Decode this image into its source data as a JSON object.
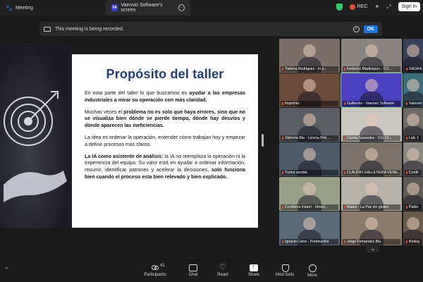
{
  "tabs": {
    "meeting": "Meeting",
    "share": "Vaenvio Software's screen",
    "share_badge": "VA"
  },
  "topbar": {
    "rec_label": "REC",
    "signin_label": "Sign in"
  },
  "banner": {
    "text": "This meeting is being recorded.",
    "ok_label": "OK"
  },
  "slide": {
    "title": "Propósito del taller",
    "paragraphs": [
      {
        "parts": [
          {
            "t": "En esta parte del taller lo que buscamos es ",
            "b": false
          },
          {
            "t": "ayudar a las empresas industriales a mirar su operación con más claridad.",
            "b": true
          }
        ]
      },
      {
        "parts": [
          {
            "t": "Muchas veces el ",
            "b": false
          },
          {
            "t": "problema no es solo que haya errores, sino que no se visualiza bien dónde se pierde tiempo, dónde hay desvíos y dónde aparecen las ineficiencias.",
            "b": true
          }
        ]
      },
      {
        "parts": [
          {
            "t": "La idea es ordenar la operación, entender cómo trabajan hoy y empezar a definir procesos más claros.",
            "b": false
          }
        ]
      },
      {
        "parts": [
          {
            "t": "La IA como asistente de análisis:",
            "b": true
          },
          {
            "t": " la IA no reemplaza la operación ni la experiencia del equipo. Su valor está en ayudar a ordenar información, resumir, identificar patrones y acelerar la decisiones, ",
            "b": false
          },
          {
            "t": "solo funciona bien cuando el proceso esta bien relevado y bien explicado.",
            "b": true
          }
        ]
      }
    ]
  },
  "participants": [
    {
      "name": "Yamina Rodriguez - In p...",
      "bg": "#7a6f68"
    },
    {
      "name": "Federico Martinazzo - CO...",
      "bg": "#8a8580"
    },
    {
      "name": "SAGRA",
      "bg": "#3a3f5a"
    },
    {
      "name": "Imprimer",
      "bg": "#6b4a3a"
    },
    {
      "name": "Guillermo - Vaenvio Software",
      "bg": "#4a3fbf"
    },
    {
      "name": "Vaenvio S",
      "bg": "#3b6e7a"
    },
    {
      "name": "Vidrieria Bia - Lorena Pob...",
      "bg": "#5a5e62"
    },
    {
      "name": "Carola Saavedra - CIU Ur...",
      "bg": "#c9c6c0"
    },
    {
      "name": "Lab. L",
      "bg": "#6c6a66"
    },
    {
      "name": "Yunior arcobe",
      "bg": "#4d5a6a"
    },
    {
      "name": "CLAUDIO GALLETERIA VENE...",
      "bg": "#7b7368"
    },
    {
      "name": "Confir",
      "bg": "#8a8680"
    },
    {
      "name": "Confiteria Irisarri - Ximen...",
      "bg": "#9aa088"
    },
    {
      "name": "Mateo - La Paz sin gluten",
      "bg": "#b5b0a8"
    },
    {
      "name": "Pablo",
      "bg": "#5e5a56"
    },
    {
      "name": "Ignacio Carre - Pontevedra",
      "bg": "#5a6a78"
    },
    {
      "name": "Jorge Fernandez Bia",
      "bg": "#8c7a6a"
    },
    {
      "name": "Bodeg",
      "bg": "#6a5a4a"
    }
  ],
  "toolbar": {
    "participants_label": "Participants",
    "participants_count": "41",
    "chat_label": "Chat",
    "react_label": "React",
    "share_label": "Share",
    "host_tools_label": "Host tools",
    "more_label": "More"
  },
  "colors": {
    "accent": "#1473e6",
    "rec": "#e74c3c",
    "slide_title": "#1f3d7a"
  }
}
